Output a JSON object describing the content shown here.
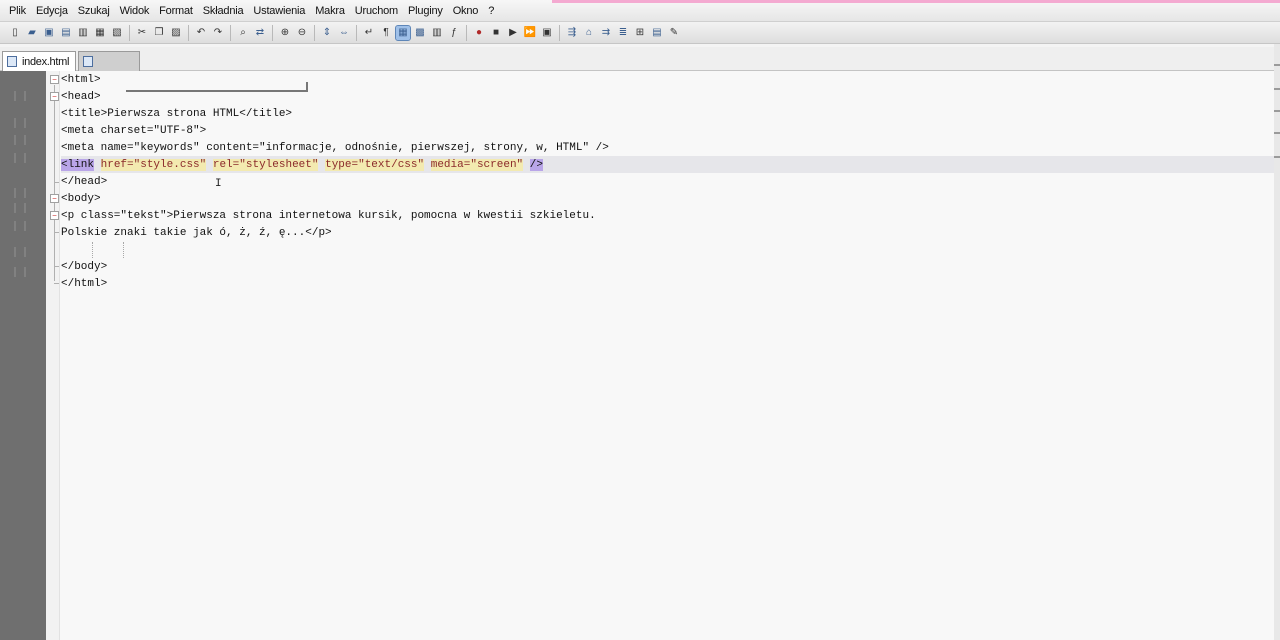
{
  "menu": [
    "Plik",
    "Edycja",
    "Szukaj",
    "Widok",
    "Format",
    "Składnia",
    "Ustawienia",
    "Makra",
    "Uruchom",
    "Pluginy",
    "Okno",
    "?"
  ],
  "tabs": [
    {
      "label": "index.html",
      "active": true
    },
    {
      "label": "",
      "active": false
    }
  ],
  "code_lines": [
    "<html>",
    "<head>",
    "<title>Pierwsza strona HTML</title>",
    "<meta charset=\"UTF-8\">",
    "<meta name=\"keywords\" content=\"informacje, odnośnie, pierwszej, strony, w, HTML\" />",
    "<link href=\"style.css\" rel=\"stylesheet\" type=\"text/css\" media=\"screen\" />",
    "</head>",
    "<body>",
    "<p class=\"tekst\">Pierwsza strona internetowa kursik, pomocna w kwestii szkieletu.",
    "Polskie znaki takie jak ó, ż, ź, ę...</p>",
    "",
    "</body>",
    "</html>"
  ],
  "link_line": {
    "tag_open": "<link",
    "href_attr": "href=\"style.css\"",
    "rel_attr": "rel=\"stylesheet\"",
    "type_attr": "type=\"text/css\"",
    "media_attr": "media=\"screen\"",
    "tag_close": "/>"
  },
  "highlighted_line_index": 5,
  "colors": {
    "gutter": "#6f6f6f",
    "tag_selection": "#b9a5e8",
    "attr_selection": "#f3eab0",
    "attribute_text": "#8b2a2a",
    "string_text": "#1f1f8a"
  }
}
